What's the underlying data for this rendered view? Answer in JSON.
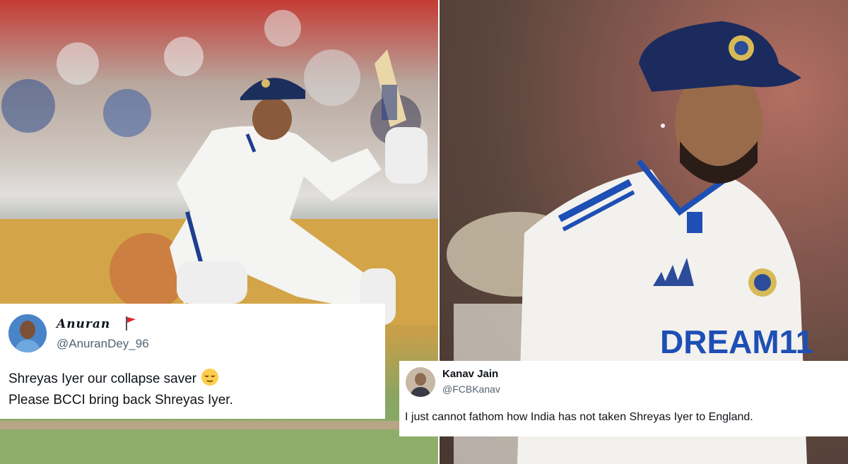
{
  "tweets": [
    {
      "name": "Anuran",
      "handle": "@AnuranDey_96",
      "text_line1": "Shreyas Iyer our collapse saver",
      "text_line2": "Please BCCI bring back Shreyas Iyer.",
      "avatar": "avatar-photo",
      "badge_icon": "red-flag-icon",
      "emoji_icon": "relieved-face-icon"
    },
    {
      "name": "Kanav Jain",
      "handle": "@FCBKanav",
      "text": "I just cannot fathom how India has not taken Shreyas Iyer to England.",
      "avatar": "avatar-photo"
    }
  ],
  "photos": {
    "left_jersey_text": "",
    "right_jersey_text": "DREAM11"
  }
}
